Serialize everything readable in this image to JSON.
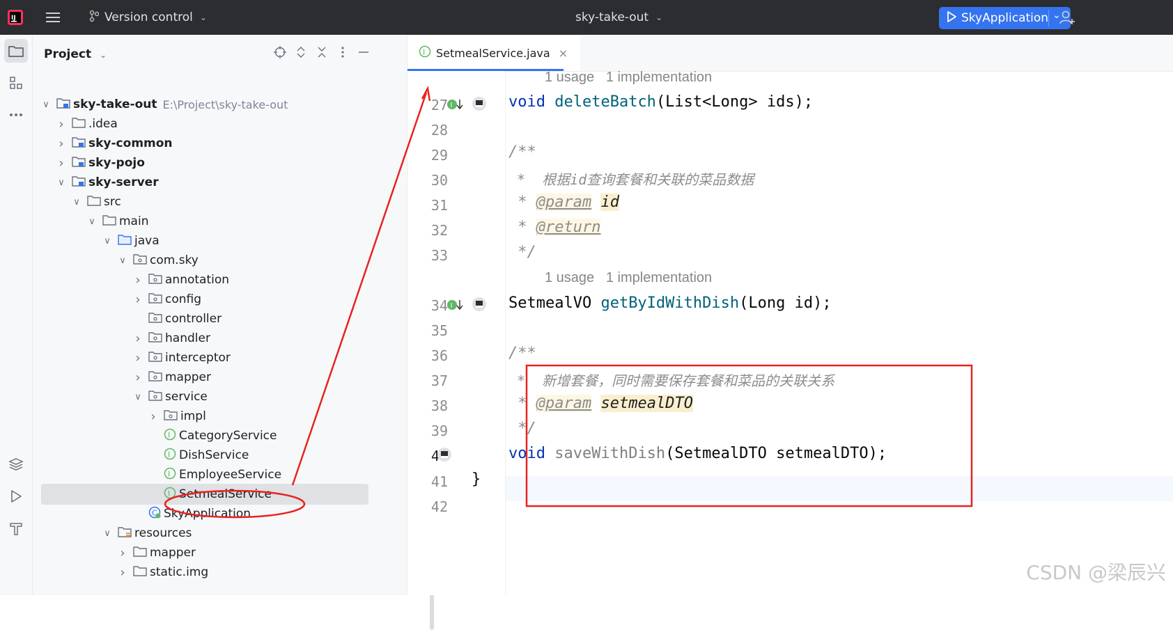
{
  "topbar": {
    "version_control": "Version control",
    "project_name": "sky-take-out",
    "run_config": "SkyApplication"
  },
  "project_panel": {
    "title": "Project",
    "tree": [
      {
        "label": "sky-take-out",
        "path": "E:\\Project\\sky-take-out",
        "depth": 0,
        "expanded": true,
        "icon": "module-folder-icon",
        "bold": true
      },
      {
        "label": ".idea",
        "depth": 1,
        "expanded": false,
        "icon": "folder-icon"
      },
      {
        "label": "sky-common",
        "depth": 1,
        "expanded": false,
        "icon": "module-folder-icon",
        "bold": true
      },
      {
        "label": "sky-pojo",
        "depth": 1,
        "expanded": false,
        "icon": "module-folder-icon",
        "bold": true
      },
      {
        "label": "sky-server",
        "depth": 1,
        "expanded": true,
        "icon": "module-folder-icon",
        "bold": true
      },
      {
        "label": "src",
        "depth": 2,
        "expanded": true,
        "icon": "folder-icon"
      },
      {
        "label": "main",
        "depth": 3,
        "expanded": true,
        "icon": "folder-icon"
      },
      {
        "label": "java",
        "depth": 4,
        "expanded": true,
        "icon": "source-folder-icon"
      },
      {
        "label": "com.sky",
        "depth": 5,
        "expanded": true,
        "icon": "package-icon"
      },
      {
        "label": "annotation",
        "depth": 6,
        "expanded": false,
        "icon": "package-icon"
      },
      {
        "label": "config",
        "depth": 6,
        "expanded": false,
        "icon": "package-icon"
      },
      {
        "label": "controller",
        "depth": 6,
        "expanded": null,
        "icon": "package-icon"
      },
      {
        "label": "handler",
        "depth": 6,
        "expanded": false,
        "icon": "package-icon"
      },
      {
        "label": "interceptor",
        "depth": 6,
        "expanded": false,
        "icon": "package-icon"
      },
      {
        "label": "mapper",
        "depth": 6,
        "expanded": false,
        "icon": "package-icon"
      },
      {
        "label": "service",
        "depth": 6,
        "expanded": true,
        "icon": "package-icon"
      },
      {
        "label": "impl",
        "depth": 7,
        "expanded": false,
        "icon": "package-icon"
      },
      {
        "label": "CategoryService",
        "depth": 7,
        "expanded": null,
        "icon": "interface-icon"
      },
      {
        "label": "DishService",
        "depth": 7,
        "expanded": null,
        "icon": "interface-icon"
      },
      {
        "label": "EmployeeService",
        "depth": 7,
        "expanded": null,
        "icon": "interface-icon"
      },
      {
        "label": "SetmealService",
        "depth": 7,
        "expanded": null,
        "icon": "interface-icon",
        "selected": true
      },
      {
        "label": "SkyApplication",
        "depth": 6,
        "expanded": null,
        "icon": "spring-app-icon"
      },
      {
        "label": "resources",
        "depth": 4,
        "expanded": true,
        "icon": "resources-folder-icon"
      },
      {
        "label": "mapper",
        "depth": 5,
        "expanded": false,
        "icon": "folder-icon"
      },
      {
        "label": "static.img",
        "depth": 5,
        "expanded": false,
        "icon": "folder-icon"
      }
    ]
  },
  "editor": {
    "tab_label": "SetmealService.java",
    "hint_top": {
      "usages": "1 usage",
      "impl": "1 implementation"
    },
    "hint_mid": {
      "usages": "1 usage",
      "impl": "1 implementation"
    },
    "line_numbers": [
      "27",
      "28",
      "29",
      "30",
      "31",
      "32",
      "33",
      "34",
      "35",
      "36",
      "37",
      "38",
      "39",
      "40",
      "41",
      "42"
    ],
    "code": {
      "l27_kw": "void",
      "l27_fn": "deleteBatch",
      "l27_rest": "(List<Long> ids);",
      "l29": "/**",
      "l30": " *  根据id查询套餐和关联的菜品数据",
      "l31_star": " * ",
      "l31_tag": "@param",
      "l31_name": "id",
      "l32_star": " * ",
      "l32_tag": "@return",
      "l33": " */",
      "l34_type": "SetmealVO ",
      "l34_fn": "getByIdWithDish",
      "l34_rest": "(Long id);",
      "l36": "/**",
      "l37": " *  新增套餐，同时需要保存套餐和菜品的关联关系",
      "l38_star": " * ",
      "l38_tag": "@param",
      "l38_name": "setmealDTO",
      "l39": " */",
      "l40_kw": "void",
      "l40_fn": "saveWithDish",
      "l40_rest": "(SetmealDTO setmealDTO);",
      "l41": "}"
    }
  },
  "watermark": "CSDN @梁辰兴",
  "colors": {
    "accent": "#3574f0",
    "annotation_red": "#e8231f",
    "topbar_bg": "#2b2d30"
  }
}
